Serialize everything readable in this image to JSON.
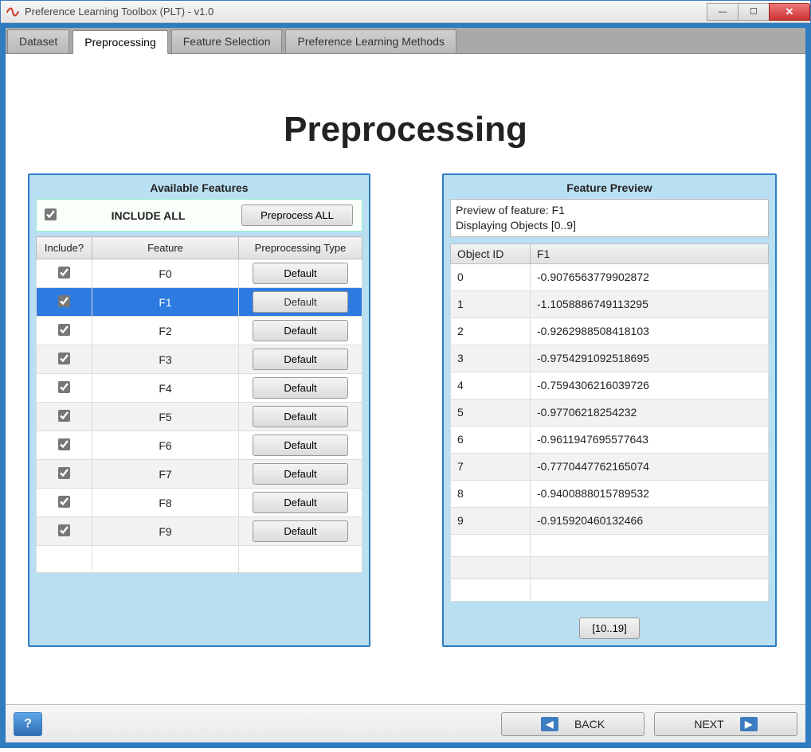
{
  "window": {
    "title": "Preference Learning Toolbox (PLT) - v1.0"
  },
  "tabs": [
    {
      "label": "Dataset",
      "active": false
    },
    {
      "label": "Preprocessing",
      "active": true
    },
    {
      "label": "Feature Selection",
      "active": false
    },
    {
      "label": "Preference Learning Methods",
      "active": false
    }
  ],
  "page": {
    "heading": "Preprocessing"
  },
  "features_panel": {
    "title": "Available Features",
    "include_all_label": "INCLUDE ALL",
    "preprocess_all_label": "Preprocess ALL",
    "headers": {
      "include": "Include?",
      "feature": "Feature",
      "type": "Preprocessing Type"
    },
    "rows": [
      {
        "include": true,
        "feature": "F0",
        "type": "Default",
        "selected": false
      },
      {
        "include": true,
        "feature": "F1",
        "type": "Default",
        "selected": true
      },
      {
        "include": true,
        "feature": "F2",
        "type": "Default",
        "selected": false
      },
      {
        "include": true,
        "feature": "F3",
        "type": "Default",
        "selected": false
      },
      {
        "include": true,
        "feature": "F4",
        "type": "Default",
        "selected": false
      },
      {
        "include": true,
        "feature": "F5",
        "type": "Default",
        "selected": false
      },
      {
        "include": true,
        "feature": "F6",
        "type": "Default",
        "selected": false
      },
      {
        "include": true,
        "feature": "F7",
        "type": "Default",
        "selected": false
      },
      {
        "include": true,
        "feature": "F8",
        "type": "Default",
        "selected": false
      },
      {
        "include": true,
        "feature": "F9",
        "type": "Default",
        "selected": false
      }
    ]
  },
  "preview_panel": {
    "title": "Feature Preview",
    "info_line1": "Preview of feature: F1",
    "info_line2": "Displaying Objects [0..9]",
    "headers": {
      "id": "Object ID",
      "value": "F1"
    },
    "rows": [
      {
        "id": "0",
        "value": "-0.9076563779902872"
      },
      {
        "id": "1",
        "value": "-1.1058886749113295"
      },
      {
        "id": "2",
        "value": "-0.9262988508418103"
      },
      {
        "id": "3",
        "value": "-0.9754291092518695"
      },
      {
        "id": "4",
        "value": "-0.7594306216039726"
      },
      {
        "id": "5",
        "value": "-0.97706218254232"
      },
      {
        "id": "6",
        "value": "-0.9611947695577643"
      },
      {
        "id": "7",
        "value": "-0.7770447762165074"
      },
      {
        "id": "8",
        "value": "-0.9400888015789532"
      },
      {
        "id": "9",
        "value": "-0.915920460132466"
      }
    ],
    "empty_rows": 3,
    "pager_label": "[10..19]"
  },
  "footer": {
    "back": "BACK",
    "next": "NEXT"
  }
}
